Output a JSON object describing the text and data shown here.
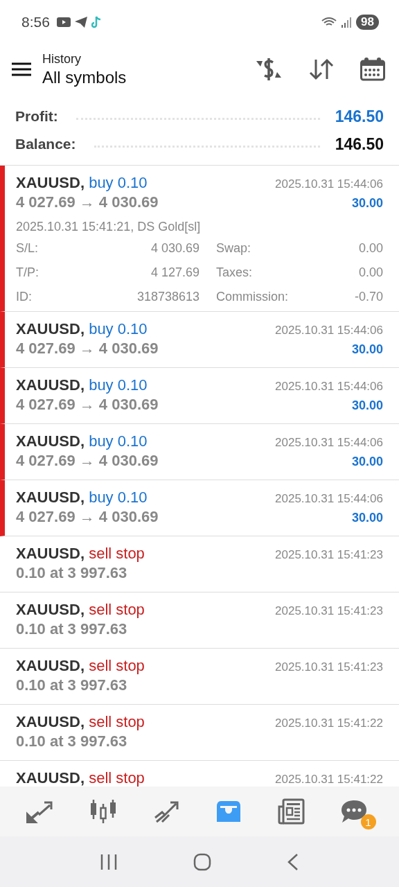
{
  "status_bar": {
    "time": "8:56",
    "battery": "98"
  },
  "header": {
    "subtitle": "History",
    "title": "All symbols"
  },
  "summary": [
    {
      "label": "Profit:",
      "value": "146.50",
      "kind": "profit"
    },
    {
      "label": "Balance:",
      "value": "146.50",
      "kind": "balance"
    }
  ],
  "rows": [
    {
      "kind": "deal",
      "symbol": "XAUUSD,",
      "side": "buy 0.10",
      "line": "4 027.69 → 4 030.69",
      "time": "2025.10.31 15:44:06",
      "profit": "30.00",
      "expanded": true,
      "info": "2025.10.31 15:41:21, DS Gold[sl]",
      "details": [
        [
          "S/L:",
          "4 030.69",
          "Swap:",
          "0.00"
        ],
        [
          "T/P:",
          "4 127.69",
          "Taxes:",
          "0.00"
        ],
        [
          "ID:",
          "318738613",
          "Commission:",
          "-0.70"
        ]
      ]
    },
    {
      "kind": "deal",
      "symbol": "XAUUSD,",
      "side": "buy 0.10",
      "line": "4 027.69 → 4 030.69",
      "time": "2025.10.31 15:44:06",
      "profit": "30.00",
      "expanded": false
    },
    {
      "kind": "deal",
      "symbol": "XAUUSD,",
      "side": "buy 0.10",
      "line": "4 027.69 → 4 030.69",
      "time": "2025.10.31 15:44:06",
      "profit": "30.00",
      "expanded": false
    },
    {
      "kind": "deal",
      "symbol": "XAUUSD,",
      "side": "buy 0.10",
      "line": "4 027.69 → 4 030.69",
      "time": "2025.10.31 15:44:06",
      "profit": "30.00",
      "expanded": false
    },
    {
      "kind": "deal",
      "symbol": "XAUUSD,",
      "side": "buy 0.10",
      "line": "4 027.69 → 4 030.69",
      "time": "2025.10.31 15:44:06",
      "profit": "30.00",
      "expanded": false
    },
    {
      "kind": "order",
      "symbol": "XAUUSD,",
      "side": "sell stop",
      "line": "0.10 at 3 997.63",
      "time": "2025.10.31 15:41:23"
    },
    {
      "kind": "order",
      "symbol": "XAUUSD,",
      "side": "sell stop",
      "line": "0.10 at 3 997.63",
      "time": "2025.10.31 15:41:23"
    },
    {
      "kind": "order",
      "symbol": "XAUUSD,",
      "side": "sell stop",
      "line": "0.10 at 3 997.63",
      "time": "2025.10.31 15:41:23"
    },
    {
      "kind": "order",
      "symbol": "XAUUSD,",
      "side": "sell stop",
      "line": "0.10 at 3 997.63",
      "time": "2025.10.31 15:41:22"
    },
    {
      "kind": "order",
      "symbol": "XAUUSD,",
      "side": "sell stop",
      "time": "2025.10.31 15:41:22"
    }
  ],
  "tabs": [
    {
      "kind": "trade",
      "selected": false
    },
    {
      "kind": "quotes",
      "selected": false
    },
    {
      "kind": "chart",
      "selected": false
    },
    {
      "kind": "history",
      "selected": true
    },
    {
      "kind": "news",
      "selected": false
    },
    {
      "kind": "chat",
      "selected": false,
      "badge": "1"
    }
  ]
}
